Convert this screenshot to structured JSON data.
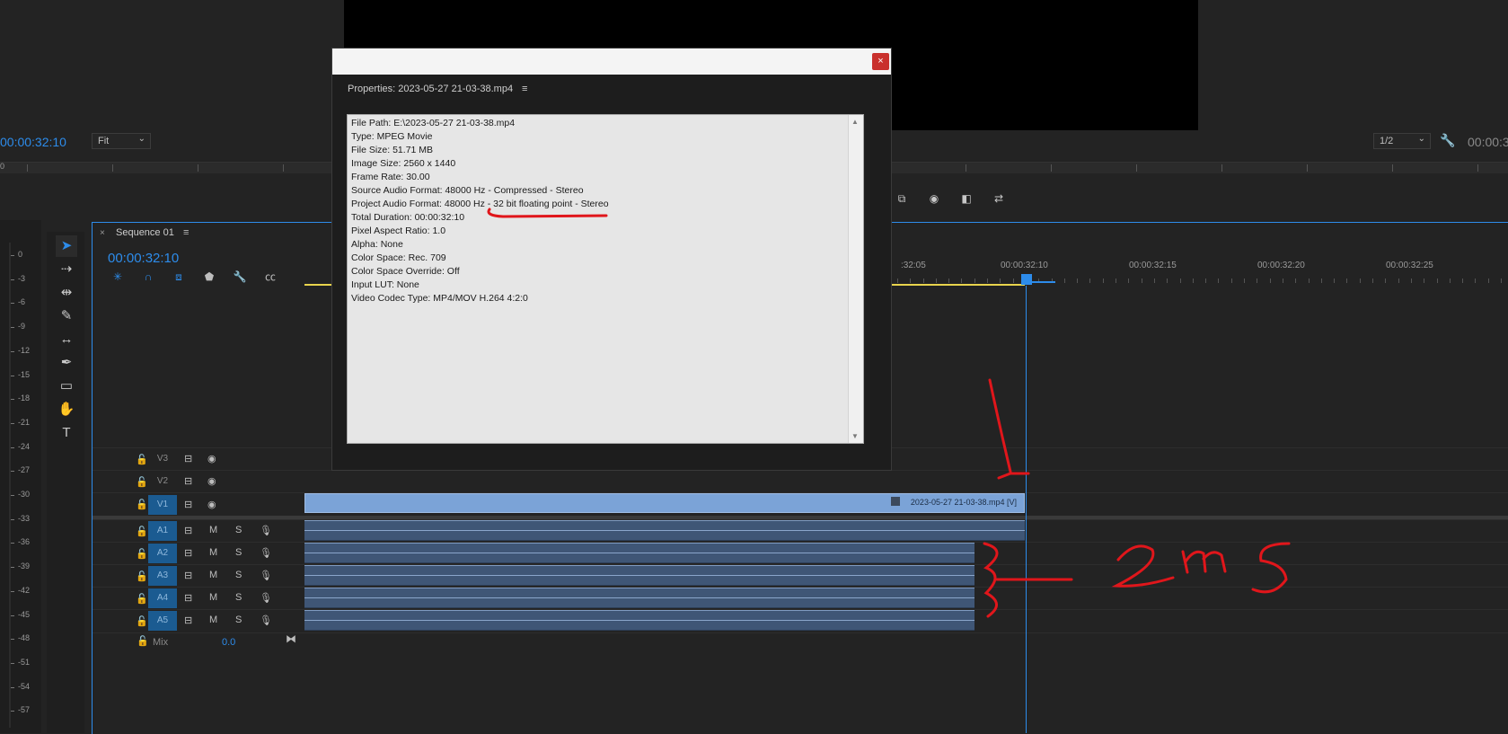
{
  "program_monitor": {
    "timecode": "00:00:32:10",
    "fit_label": "Fit",
    "resolution_label": "1/2",
    "right_timecode": "00:00:3",
    "zoom_indicator": "0"
  },
  "meter": {
    "labels": [
      "0",
      "-3",
      "-6",
      "-9",
      "-12",
      "-15",
      "-18",
      "-21",
      "-24",
      "-27",
      "-30",
      "-33",
      "-36",
      "-39",
      "-42",
      "-45",
      "-48",
      "-51",
      "-54",
      "-57"
    ]
  },
  "sequence": {
    "title": "Sequence 01",
    "timecode": "00:00:32:10",
    "ruler_labels": [
      "00:00:32:05",
      "00:00:32:10",
      "00:00:32:15",
      "00:00:32:20",
      "00:00:32:25"
    ],
    "ruler_first_visible": ":32:05"
  },
  "tracks": {
    "video": [
      {
        "name": "V3",
        "active": false
      },
      {
        "name": "V2",
        "active": false
      },
      {
        "name": "V1",
        "active": true
      }
    ],
    "audio": [
      {
        "name": "A1",
        "mute": "M",
        "solo": "S"
      },
      {
        "name": "A2",
        "mute": "M",
        "solo": "S"
      },
      {
        "name": "A3",
        "mute": "M",
        "solo": "S"
      },
      {
        "name": "A4",
        "mute": "M",
        "solo": "S"
      },
      {
        "name": "A5",
        "mute": "M",
        "solo": "S"
      }
    ],
    "mix": {
      "label": "Mix",
      "value": "0.0"
    }
  },
  "clip": {
    "label": "2023-05-27 21-03-38.mp4 [V]"
  },
  "dialog": {
    "close_label": "×",
    "title": "Properties: 2023-05-27 21-03-38.mp4",
    "menu_icon": "≡",
    "lines": [
      "File Path: E:\\2023-05-27 21-03-38.mp4",
      "Type: MPEG Movie",
      "File Size: 51.71 MB",
      "Image Size: 2560 x 1440",
      "Frame Rate: 30.00",
      "Source Audio Format: 48000 Hz - Compressed - Stereo",
      "Project Audio Format: 48000 Hz - 32 bit floating point - Stereo",
      "Total Duration: 00:00:32:10",
      "Pixel Aspect Ratio: 1.0",
      "Alpha: None",
      "Color Space: Rec. 709",
      "Color Space Override: Off",
      "Input LUT: None",
      "Video Codec Type: MP4/MOV H.264 4:2:0"
    ]
  },
  "colors": {
    "accent": "#2d8ceb",
    "clip_video": "#7ba3d7",
    "clip_audio": "#3f5676",
    "annotation": "#e0161b",
    "work_area": "#e8d44d"
  }
}
